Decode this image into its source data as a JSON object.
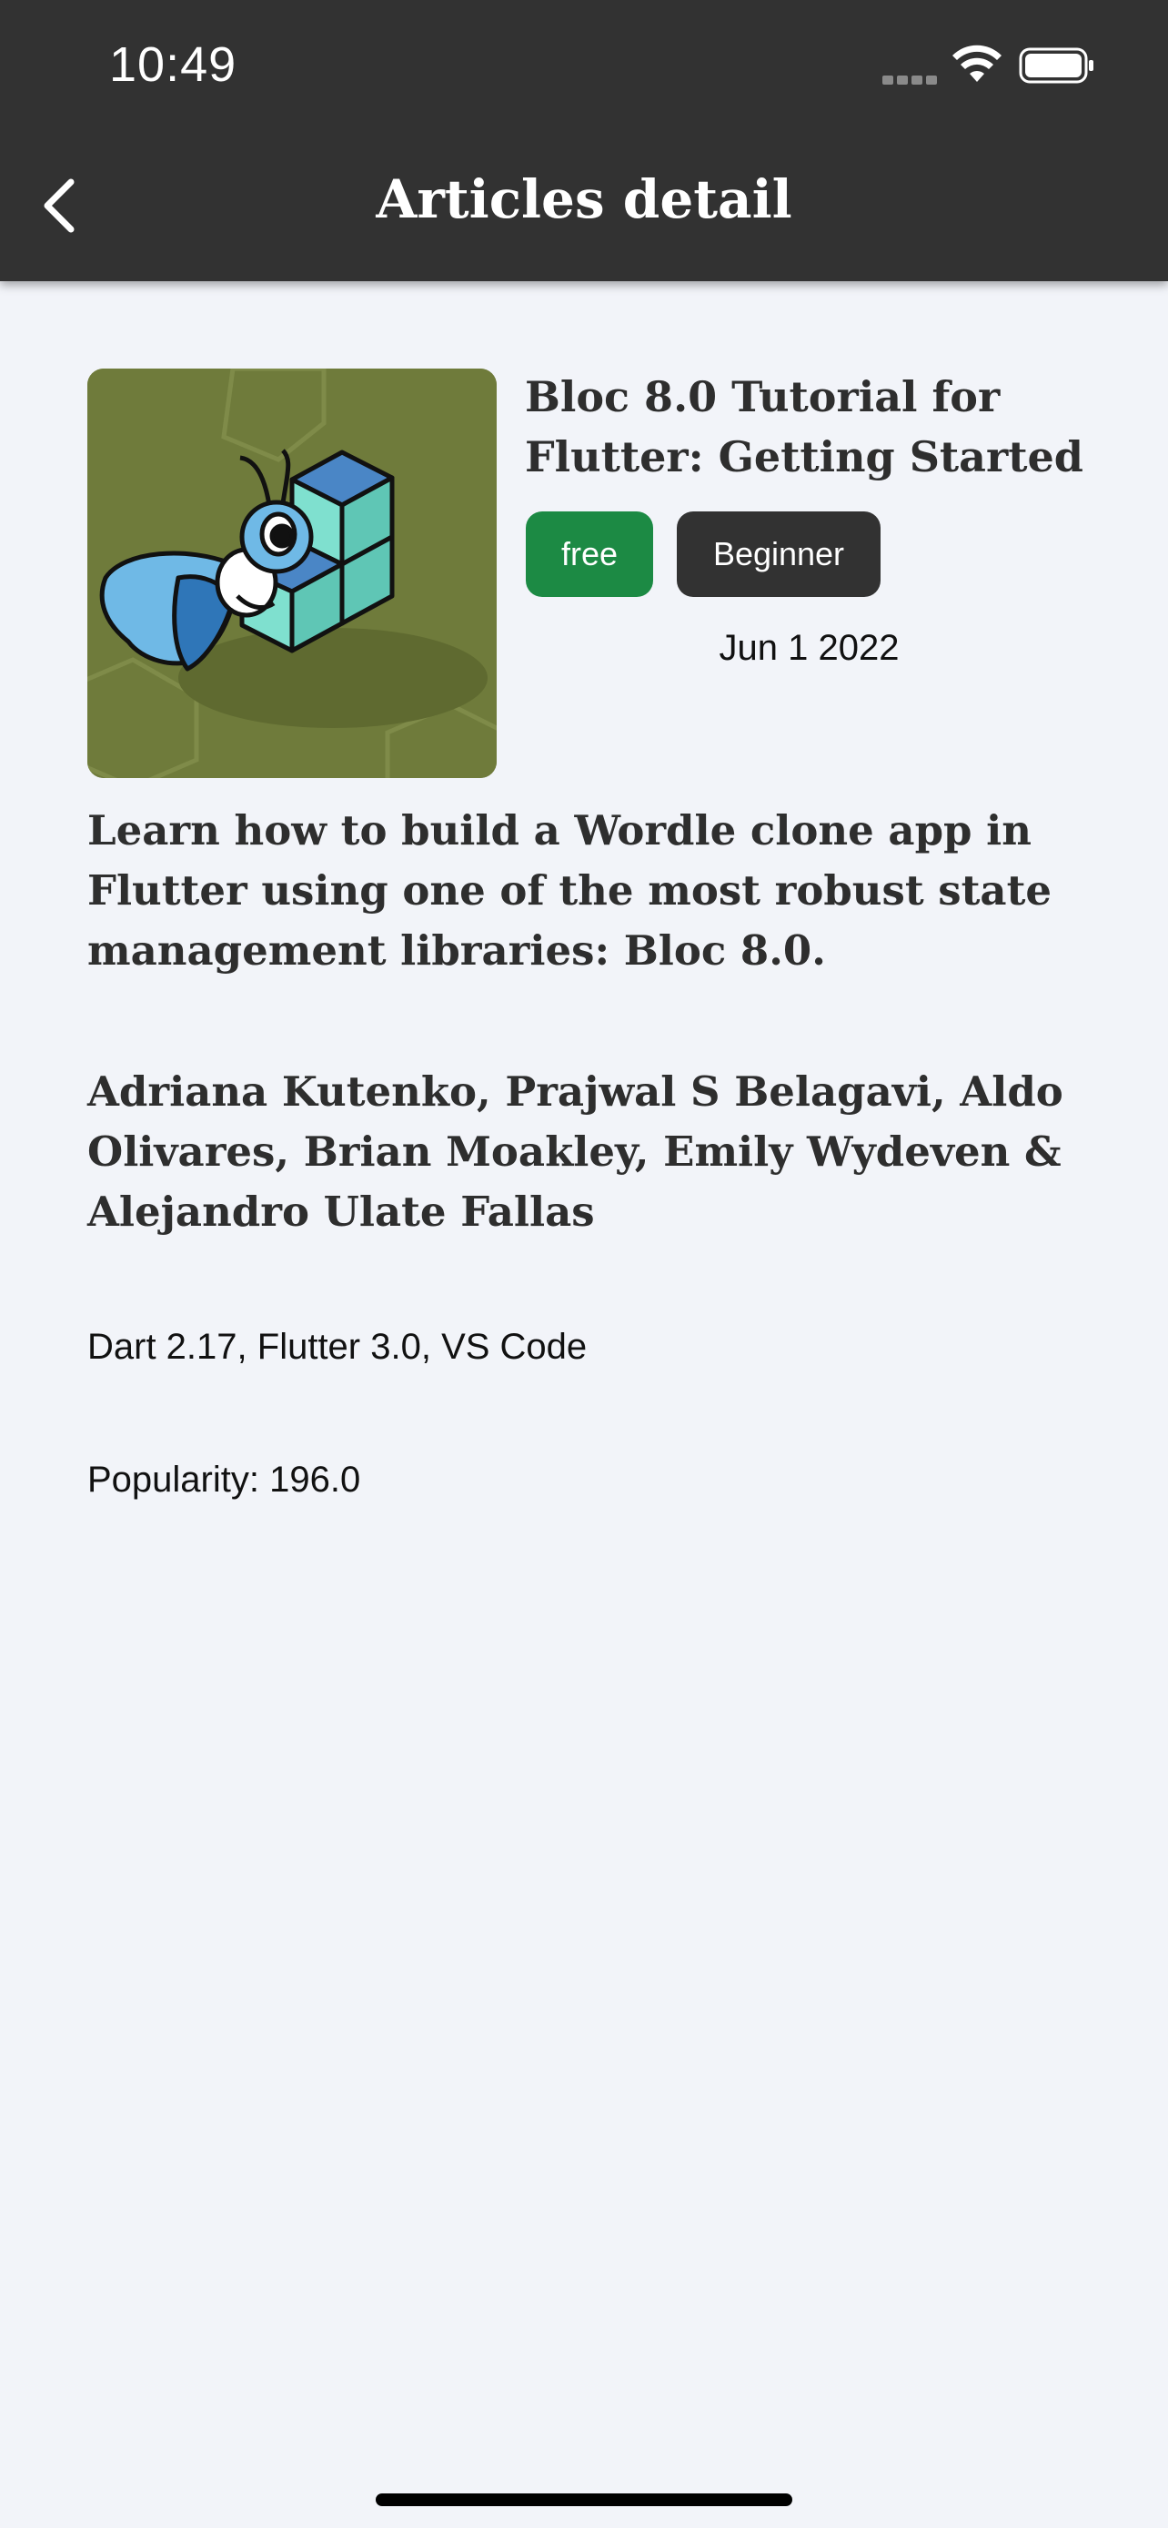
{
  "status_bar": {
    "time": "10:49",
    "icons": [
      "cellular-signal-icon",
      "wifi-icon",
      "battery-icon"
    ]
  },
  "nav": {
    "back_icon": "chevron-left-icon",
    "title": "Articles detail"
  },
  "article": {
    "image_subject": "bloc-bee-with-cubes-illustration",
    "title": "Bloc 8.0 Tutorial for Flutter: Getting Started",
    "badges": {
      "price": "free",
      "level": "Beginner"
    },
    "date": "Jun 1 2022",
    "description": "Learn how to build a Wordle clone app in Flutter using one of the most robust state management libraries: Bloc 8.0.",
    "authors": "Adriana Kutenko, Prajwal S Belagavi, Aldo Olivares, Brian Moakley, Emily Wydeven & Alejandro Ulate Fallas",
    "technologies": "Dart 2.17, Flutter 3.0, VS Code",
    "popularity": "Popularity: 196.0"
  },
  "colors": {
    "app_bar": "#323232",
    "background": "#f2f4f9",
    "badge_free": "#1c8a44",
    "badge_level": "#323232",
    "text_primary": "#2e2e2e"
  }
}
